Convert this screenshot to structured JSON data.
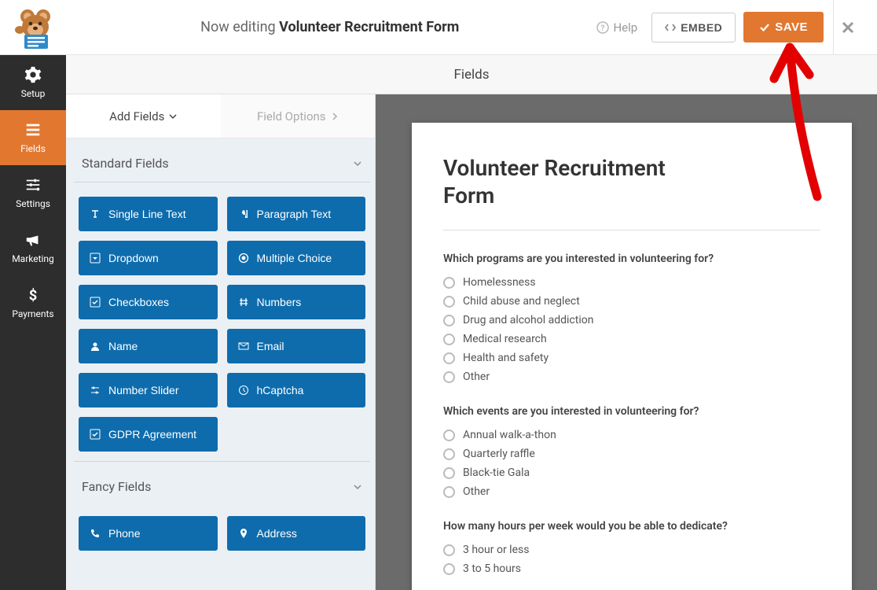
{
  "topbar": {
    "editing_prefix": "Now editing",
    "form_name": "Volunteer Recruitment Form",
    "help_label": "Help",
    "embed_label": "EMBED",
    "save_label": "SAVE"
  },
  "left_nav": [
    {
      "key": "setup",
      "label": "Setup"
    },
    {
      "key": "fields",
      "label": "Fields"
    },
    {
      "key": "settings",
      "label": "Settings"
    },
    {
      "key": "marketing",
      "label": "Marketing"
    },
    {
      "key": "payments",
      "label": "Payments"
    }
  ],
  "header_strip": "Fields",
  "panel_tabs": {
    "add_fields": "Add Fields",
    "field_options": "Field Options"
  },
  "sections": {
    "standard": {
      "title": "Standard Fields",
      "fields": [
        "Single Line Text",
        "Paragraph Text",
        "Dropdown",
        "Multiple Choice",
        "Checkboxes",
        "Numbers",
        "Name",
        "Email",
        "Number Slider",
        "hCaptcha",
        "GDPR Agreement"
      ]
    },
    "fancy": {
      "title": "Fancy Fields",
      "fields": [
        "Phone",
        "Address"
      ]
    }
  },
  "preview": {
    "form_title": "Volunteer Recruitment Form",
    "questions": [
      {
        "label": "Which programs are you interested in volunteering for?",
        "options": [
          "Homelessness",
          "Child abuse and neglect",
          "Drug and alcohol addiction",
          "Medical research",
          "Health and safety",
          "Other"
        ]
      },
      {
        "label": "Which events are you interested in volunteering for?",
        "options": [
          "Annual walk-a-thon",
          "Quarterly raffle",
          "Black-tie Gala",
          "Other"
        ]
      },
      {
        "label": "How many hours per week would you be able to dedicate?",
        "options": [
          "3 hour or less",
          "3 to 5 hours"
        ]
      }
    ]
  }
}
